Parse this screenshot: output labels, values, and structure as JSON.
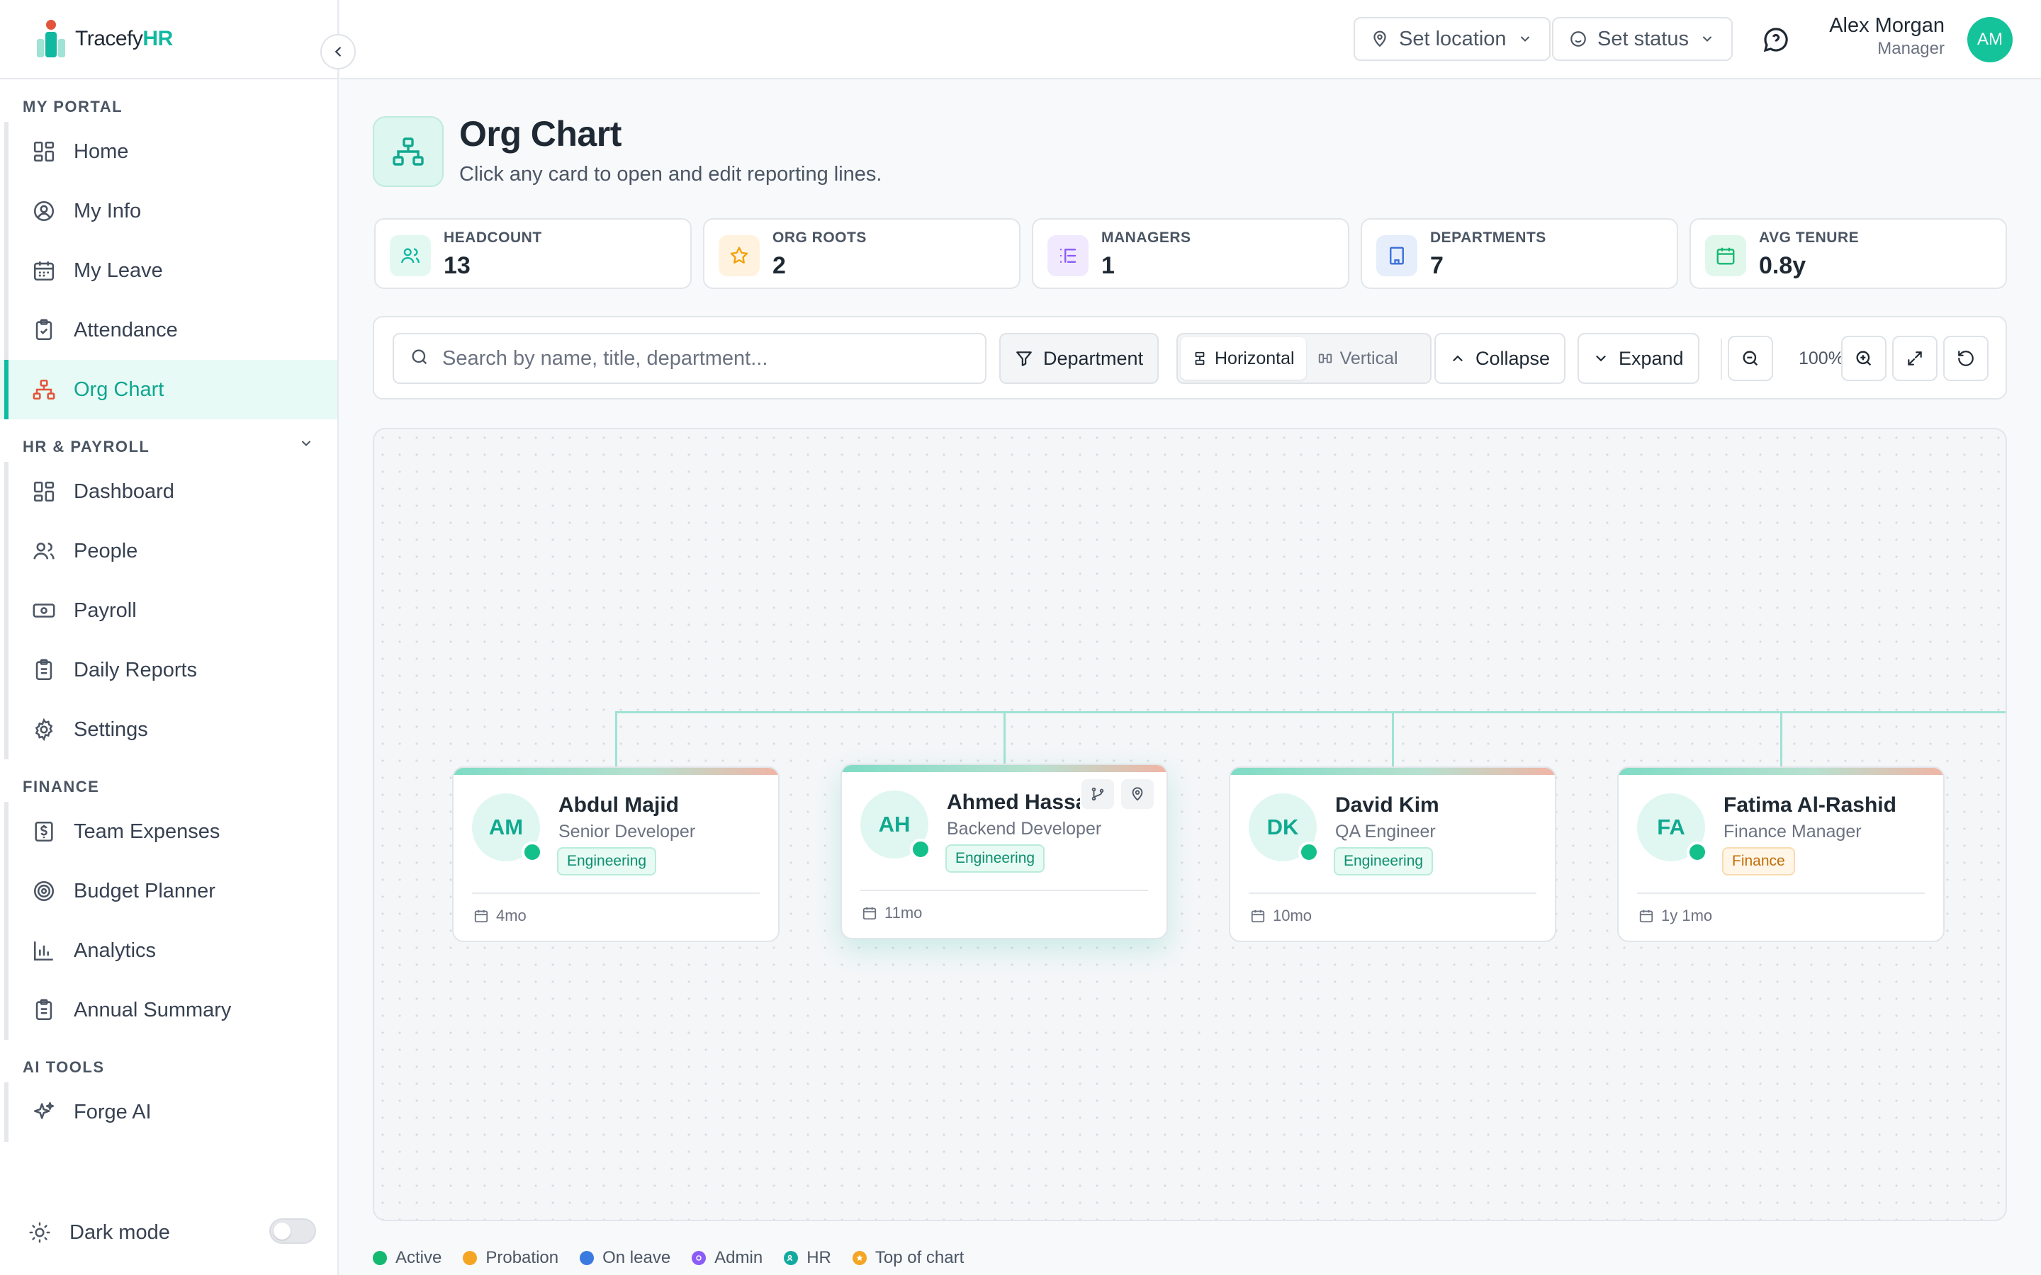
{
  "brand": {
    "name_part1": "Tracefy",
    "name_part2": "HR"
  },
  "header": {
    "location_label": "Set location",
    "status_label": "Set status",
    "user_name": "Alex Morgan",
    "user_role": "Manager",
    "user_initials": "AM"
  },
  "sidebar": {
    "sections": [
      {
        "title": "MY PORTAL",
        "items": [
          "Home",
          "My Info",
          "My Leave",
          "Attendance",
          "Org Chart"
        ]
      },
      {
        "title": "HR & PAYROLL",
        "items": [
          "Dashboard",
          "People",
          "Payroll",
          "Daily Reports",
          "Settings"
        ]
      },
      {
        "title": "FINANCE",
        "items": [
          "Team Expenses",
          "Budget Planner",
          "Analytics",
          "Annual Summary"
        ]
      },
      {
        "title": "AI TOOLS",
        "items": [
          "Forge AI"
        ]
      }
    ],
    "active_item": "Org Chart",
    "dark_mode_label": "Dark mode",
    "dark_mode_on": false
  },
  "page": {
    "title": "Org Chart",
    "subtitle": "Click any card to open and edit reporting lines."
  },
  "stats": [
    {
      "label": "HEADCOUNT",
      "value": "13",
      "icon": "people-icon",
      "color": "#10b9a0"
    },
    {
      "label": "ORG ROOTS",
      "value": "2",
      "icon": "star-icon",
      "color": "#f59e0b"
    },
    {
      "label": "MANAGERS",
      "value": "1",
      "icon": "list-tree-icon",
      "color": "#8b5cf6"
    },
    {
      "label": "DEPARTMENTS",
      "value": "7",
      "icon": "building-icon",
      "color": "#3b6fd8"
    },
    {
      "label": "AVG TENURE",
      "value": "0.8y",
      "icon": "calendar-icon",
      "color": "#14b870"
    }
  ],
  "toolbar": {
    "search_placeholder": "Search by name, title, department...",
    "department_label": "Department",
    "horizontal_label": "Horizontal",
    "vertical_label": "Vertical",
    "layout_selected": "Horizontal",
    "collapse_label": "Collapse",
    "expand_label": "Expand",
    "zoom_label": "100%"
  },
  "employees": [
    {
      "initials": "AM",
      "name": "Abdul Majid",
      "title": "Senior Developer",
      "department": "Engineering",
      "tenure": "4mo",
      "status": "Active"
    },
    {
      "initials": "AH",
      "name": "Ahmed Hassan",
      "title": "Backend Developer",
      "department": "Engineering",
      "tenure": "11mo",
      "status": "Active"
    },
    {
      "initials": "DK",
      "name": "David Kim",
      "title": "QA Engineer",
      "department": "Engineering",
      "tenure": "10mo",
      "status": "Active"
    },
    {
      "initials": "FA",
      "name": "Fatima Al-Rashid",
      "title": "Finance Manager",
      "department": "Finance",
      "tenure": "1y 1mo",
      "status": "Active"
    }
  ],
  "legend": [
    {
      "label": "Active",
      "color": "#14b870"
    },
    {
      "label": "Probation",
      "color": "#f5a524"
    },
    {
      "label": "On leave",
      "color": "#3b7be0"
    },
    {
      "label": "Admin",
      "color": "#8b5cf6"
    },
    {
      "label": "HR",
      "color": "#14a9a0"
    },
    {
      "label": "Top of chart",
      "color": "#f5a524"
    }
  ],
  "colors": {
    "accent": "#10b9a0",
    "active_bg": "#e7faf5"
  }
}
